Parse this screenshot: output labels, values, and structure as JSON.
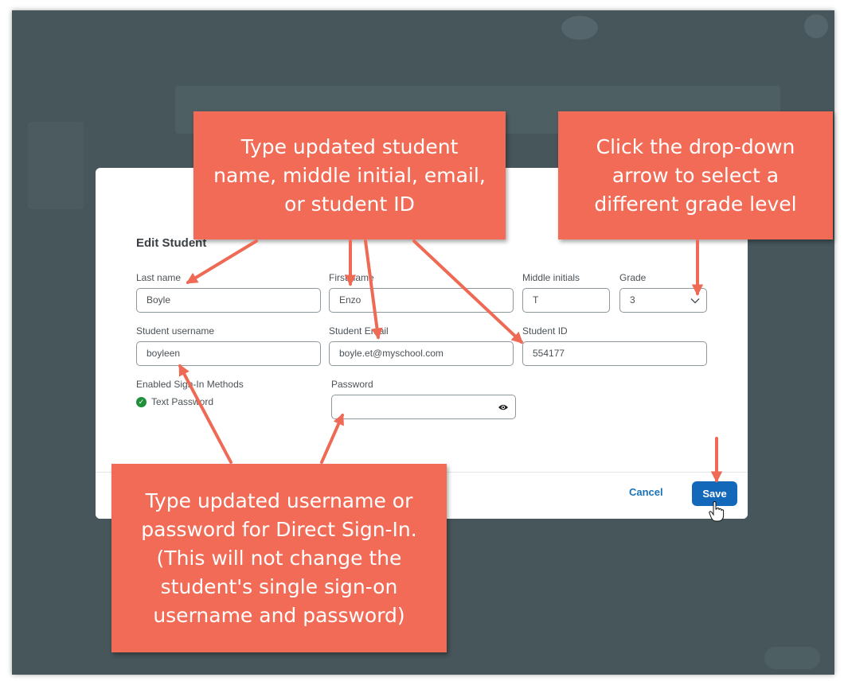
{
  "dialog": {
    "title": "Edit Student",
    "fields": {
      "last_name": {
        "label": "Last name",
        "value": "Boyle"
      },
      "first_name": {
        "label": "First name",
        "value": "Enzo"
      },
      "middle_initials": {
        "label": "Middle initials",
        "value": "T"
      },
      "grade": {
        "label": "Grade",
        "value": "3"
      },
      "student_username": {
        "label": "Student username",
        "value": "boyleen"
      },
      "student_email": {
        "label": "Student Email",
        "value": "boyle.et@myschool.com"
      },
      "student_id": {
        "label": "Student ID",
        "value": "554177"
      },
      "sign_in_methods": {
        "label": "Enabled Sign-In Methods",
        "value": "Text Password"
      },
      "password": {
        "label": "Password",
        "value": ""
      }
    },
    "buttons": {
      "cancel": "Cancel",
      "save": "Save"
    }
  },
  "callouts": {
    "top_left": [
      "Type updated student",
      "name, middle initial, email,",
      "or student ID"
    ],
    "top_right": [
      "Click the drop-down",
      "arrow to select a",
      "different grade level"
    ],
    "bottom": [
      "Type updated username or",
      "password for Direct Sign-In.",
      "(This will not change the",
      "student's single sign-on",
      "username and password)"
    ]
  },
  "colors": {
    "callout": "#f26b56",
    "arrow": "#ef6a55",
    "primary_button": "#1468b9",
    "link": "#1a73b8",
    "success": "#1f8f3a",
    "backdrop": "#46565b"
  },
  "icons": [
    "chevron-down-icon",
    "eye-icon",
    "check-circle-icon",
    "hand-cursor-icon"
  ]
}
